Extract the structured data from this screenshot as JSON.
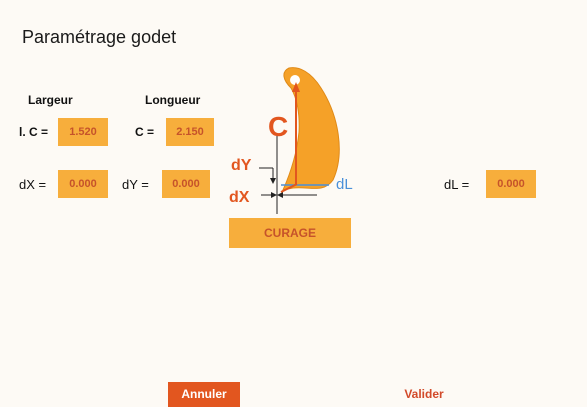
{
  "title": "Paramétrage godet",
  "largeur": {
    "heading": "Largeur",
    "c_label": "l. C =",
    "c_value": "1.520",
    "dx_label": "dX =",
    "dx_value": "0.000"
  },
  "longueur": {
    "heading": "Longueur",
    "c_label": "C =",
    "c_value": "2.150",
    "dy_label": "dY =",
    "dy_value": "0.000"
  },
  "dl": {
    "label": "dL =",
    "value": "0.000"
  },
  "diagram": {
    "c_label": "C",
    "dy_label": "dY",
    "dx_label": "dX",
    "dl_label": "dL",
    "bucket_color": "#f5a128",
    "accent_color": "#e2561f",
    "blue_color": "#4a90d9"
  },
  "curage_button": "CURAGE",
  "footer": {
    "annuler": "Annuler",
    "valider": "Valider"
  }
}
